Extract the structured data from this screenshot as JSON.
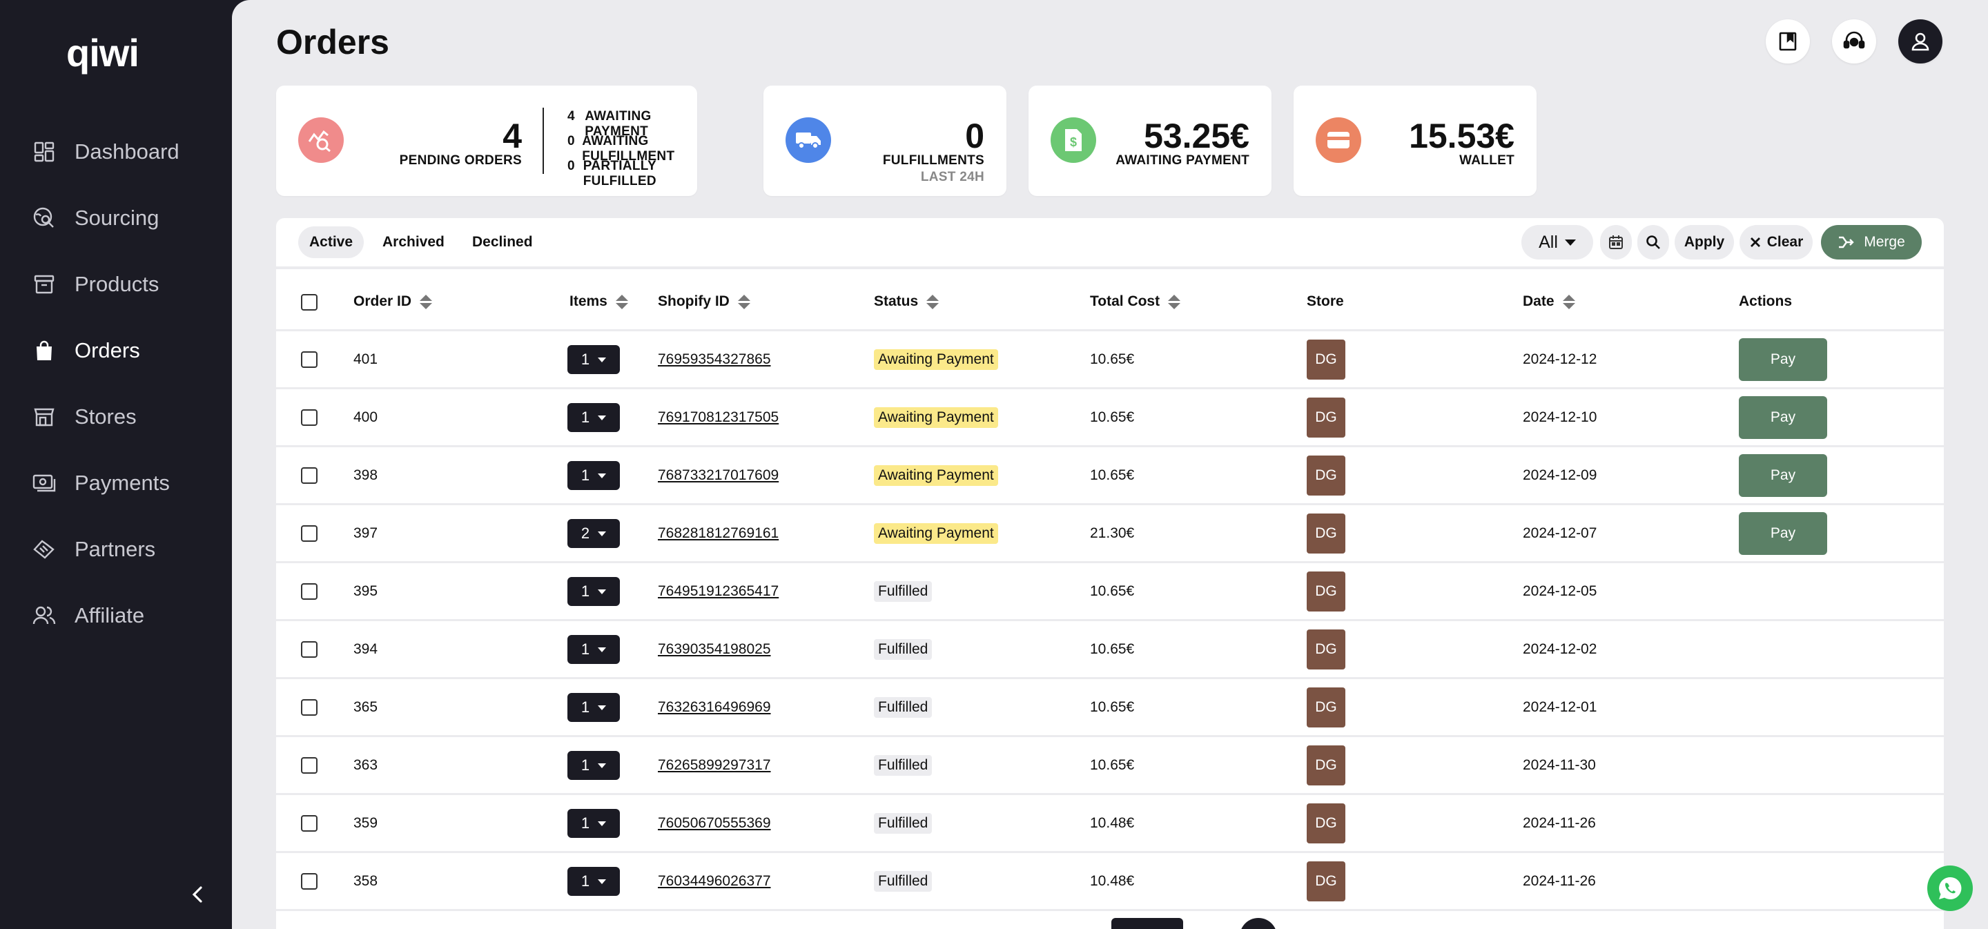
{
  "app": {
    "logo": "qiwi"
  },
  "sidebar": {
    "items": [
      {
        "label": "Dashboard",
        "icon": "dashboard-icon"
      },
      {
        "label": "Sourcing",
        "icon": "sourcing-icon"
      },
      {
        "label": "Products",
        "icon": "archive-box-icon"
      },
      {
        "label": "Orders",
        "icon": "shopping-bag-icon",
        "active": true
      },
      {
        "label": "Stores",
        "icon": "store-icon"
      },
      {
        "label": "Payments",
        "icon": "money-icon"
      },
      {
        "label": "Partners",
        "icon": "handshake-icon"
      },
      {
        "label": "Affiliate",
        "icon": "people-icon"
      }
    ]
  },
  "header": {
    "title": "Orders"
  },
  "cards": {
    "pending": {
      "value": "4",
      "label": "PENDING ORDERS",
      "breakdown": [
        {
          "num": "4",
          "label": "AWAITING PAYMENT"
        },
        {
          "num": "0",
          "label": "AWAITING FULFILLMENT"
        },
        {
          "num": "0",
          "label": "PARTIALLY FULFILLED"
        }
      ],
      "color": "#f08b8b"
    },
    "fulfillments": {
      "value": "0",
      "label": "FULFILLMENTS",
      "sub": "LAST 24H",
      "color": "#4f86e8"
    },
    "awaiting": {
      "value": "53.25€",
      "label": "AWAITING PAYMENT",
      "color": "#6cc873"
    },
    "wallet": {
      "value": "15.53€",
      "label": "WALLET",
      "color": "#ec8563"
    }
  },
  "tabs": [
    "Active",
    "Archived",
    "Declined"
  ],
  "toolbar": {
    "filter_value": "All",
    "apply": "Apply",
    "clear": "Clear",
    "merge": "Merge"
  },
  "table": {
    "columns": [
      "Order ID",
      "Items",
      "Shopify ID",
      "Status",
      "Total Cost",
      "Store",
      "Date",
      "Actions"
    ],
    "rows": [
      {
        "id": "401",
        "items": "1",
        "shopify": "76959354327865",
        "status": "Awaiting Payment",
        "cost": "10.65€",
        "store": "DG",
        "date": "2024-12-12",
        "action": "Pay"
      },
      {
        "id": "400",
        "items": "1",
        "shopify": "769170812317505",
        "status": "Awaiting Payment",
        "cost": "10.65€",
        "store": "DG",
        "date": "2024-12-10",
        "action": "Pay"
      },
      {
        "id": "398",
        "items": "1",
        "shopify": "768733217017609",
        "status": "Awaiting Payment",
        "cost": "10.65€",
        "store": "DG",
        "date": "2024-12-09",
        "action": "Pay"
      },
      {
        "id": "397",
        "items": "2",
        "shopify": "768281812769161",
        "status": "Awaiting Payment",
        "cost": "21.30€",
        "store": "DG",
        "date": "2024-12-07",
        "action": "Pay"
      },
      {
        "id": "395",
        "items": "1",
        "shopify": "764951912365417",
        "status": "Fulfilled",
        "cost": "10.65€",
        "store": "DG",
        "date": "2024-12-05",
        "action": ""
      },
      {
        "id": "394",
        "items": "1",
        "shopify": "76390354198025",
        "status": "Fulfilled",
        "cost": "10.65€",
        "store": "DG",
        "date": "2024-12-02",
        "action": ""
      },
      {
        "id": "365",
        "items": "1",
        "shopify": "76326316496969",
        "status": "Fulfilled",
        "cost": "10.65€",
        "store": "DG",
        "date": "2024-12-01",
        "action": ""
      },
      {
        "id": "363",
        "items": "1",
        "shopify": "76265899297317",
        "status": "Fulfilled",
        "cost": "10.65€",
        "store": "DG",
        "date": "2024-11-30",
        "action": ""
      },
      {
        "id": "359",
        "items": "1",
        "shopify": "76050670555369",
        "status": "Fulfilled",
        "cost": "10.48€",
        "store": "DG",
        "date": "2024-11-26",
        "action": ""
      },
      {
        "id": "358",
        "items": "1",
        "shopify": "76034496026377",
        "status": "Fulfilled",
        "cost": "10.48€",
        "store": "DG",
        "date": "2024-11-26",
        "action": ""
      }
    ]
  },
  "colors": {
    "sidebar_bg": "#1b1b24",
    "accent_green": "#5b8066",
    "awaiting_badge": "#fbe98a",
    "store_badge": "#7b5343"
  }
}
